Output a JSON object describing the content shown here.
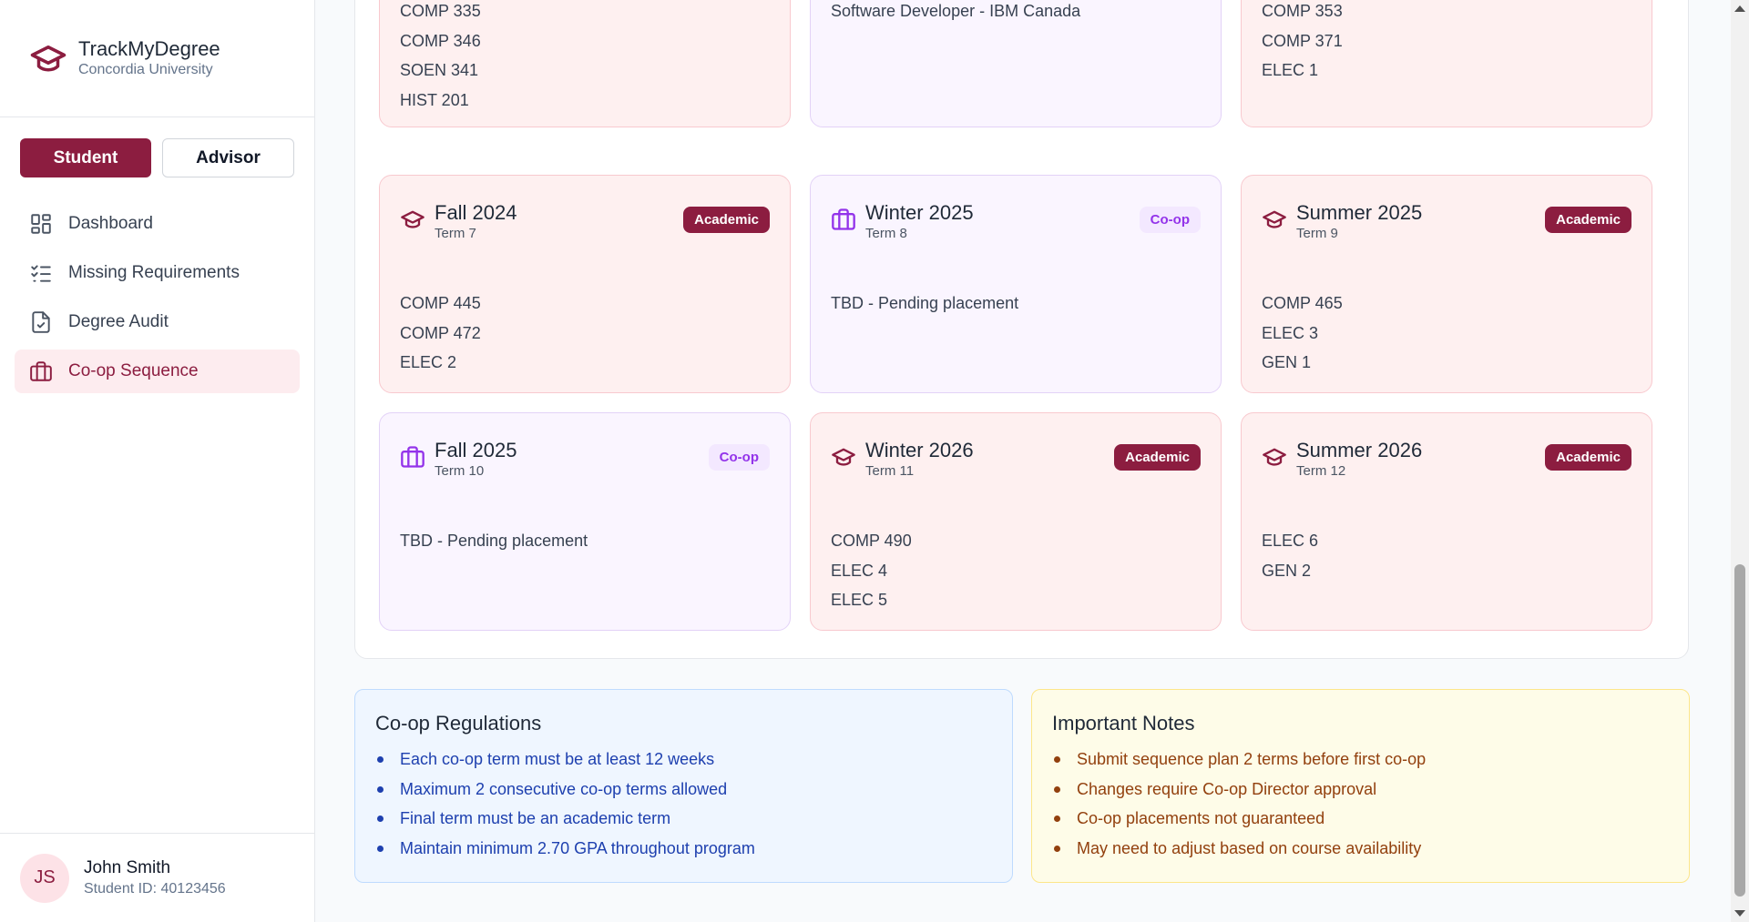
{
  "brand": {
    "title": "TrackMyDegree",
    "subtitle": "Concordia University"
  },
  "roles": {
    "student": "Student",
    "advisor": "Advisor"
  },
  "nav": {
    "dashboard": "Dashboard",
    "missing": "Missing Requirements",
    "audit": "Degree Audit",
    "coop": "Co-op Sequence"
  },
  "user": {
    "initials": "JS",
    "name": "John Smith",
    "id": "Student ID: 40123456"
  },
  "terms_top": [
    {
      "kind": "academic",
      "courses": [
        "COMP 335",
        "COMP 346",
        "SOEN 341",
        "HIST 201"
      ]
    },
    {
      "kind": "coop",
      "courses": [
        "Software Developer - IBM Canada"
      ]
    },
    {
      "kind": "academic",
      "courses": [
        "COMP 353",
        "COMP 371",
        "ELEC 1"
      ]
    }
  ],
  "terms": [
    {
      "kind": "academic",
      "name": "Fall 2024",
      "term": "Term 7",
      "badge": "Academic",
      "courses": [
        "COMP 445",
        "COMP 472",
        "ELEC 2"
      ]
    },
    {
      "kind": "coop",
      "name": "Winter 2025",
      "term": "Term 8",
      "badge": "Co-op",
      "courses": [
        "TBD - Pending placement"
      ]
    },
    {
      "kind": "academic",
      "name": "Summer 2025",
      "term": "Term 9",
      "badge": "Academic",
      "courses": [
        "COMP 465",
        "ELEC 3",
        "GEN 1"
      ]
    },
    {
      "kind": "coop",
      "name": "Fall 2025",
      "term": "Term 10",
      "badge": "Co-op",
      "courses": [
        "TBD - Pending placement"
      ]
    },
    {
      "kind": "academic",
      "name": "Winter 2026",
      "term": "Term 11",
      "badge": "Academic",
      "courses": [
        "COMP 490",
        "ELEC 4",
        "ELEC 5"
      ]
    },
    {
      "kind": "academic",
      "name": "Summer 2026",
      "term": "Term 12",
      "badge": "Academic",
      "courses": [
        "ELEC 6",
        "GEN 2"
      ]
    }
  ],
  "regulations": {
    "title": "Co-op Regulations",
    "items": [
      "Each co-op term must be at least 12 weeks",
      "Maximum 2 consecutive co-op terms allowed",
      "Final term must be an academic term",
      "Maintain minimum 2.70 GPA throughout program"
    ]
  },
  "notes": {
    "title": "Important Notes",
    "items": [
      "Submit sequence plan 2 terms before first co-op",
      "Changes require Co-op Director approval",
      "Co-op placements not guaranteed",
      "May need to adjust based on course availability"
    ]
  },
  "colors": {
    "brand": "#8c1d40",
    "coop": "#9333ea"
  }
}
